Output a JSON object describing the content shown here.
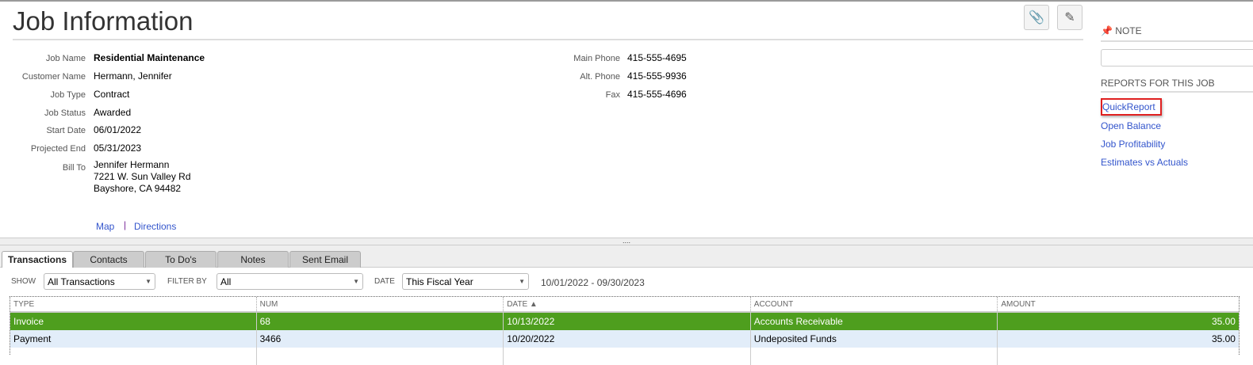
{
  "header": {
    "title": "Job Information"
  },
  "fields": {
    "job_name": {
      "label": "Job Name",
      "value": "Residential Maintenance"
    },
    "customer_name": {
      "label": "Customer Name",
      "value": "Hermann, Jennifer"
    },
    "job_type": {
      "label": "Job Type",
      "value": "Contract"
    },
    "job_status": {
      "label": "Job Status",
      "value": "Awarded"
    },
    "start_date": {
      "label": "Start Date",
      "value": "06/01/2022"
    },
    "projected_end": {
      "label": "Projected End",
      "value": "05/31/2023"
    },
    "bill_to": {
      "label": "Bill To",
      "line1": "Jennifer Hermann",
      "line2": "7221 W. Sun Valley Rd",
      "line3": "Bayshore, CA 94482"
    },
    "main_phone": {
      "label": "Main Phone",
      "value": "415-555-4695"
    },
    "alt_phone": {
      "label": "Alt. Phone",
      "value": "415-555-9936"
    },
    "fax": {
      "label": "Fax",
      "value": "415-555-4696"
    }
  },
  "links": {
    "map": "Map",
    "sep": "|",
    "directions": "Directions"
  },
  "sidebar": {
    "note_title": "NOTE",
    "reports_title": "REPORTS FOR THIS JOB",
    "reports": [
      "QuickReport",
      "Open Balance",
      "Job Profitability",
      "Estimates vs Actuals"
    ]
  },
  "divider": "....",
  "tabs": [
    "Transactions",
    "Contacts",
    "To Do's",
    "Notes",
    "Sent Email"
  ],
  "filters": {
    "show_label": "SHOW",
    "show_value": "All Transactions",
    "filter_label": "FILTER BY",
    "filter_value": "All",
    "date_label": "DATE",
    "date_value": "This Fiscal Year",
    "date_range": "10/01/2022 - 09/30/2023"
  },
  "table": {
    "headers": [
      "TYPE",
      "NUM",
      "DATE ▲",
      "ACCOUNT",
      "AMOUNT"
    ],
    "rows": [
      [
        "Invoice",
        "68",
        "10/13/2022",
        "Accounts Receivable",
        "35.00"
      ],
      [
        "Payment",
        "3466",
        "10/20/2022",
        "Undeposited Funds",
        "35.00"
      ]
    ]
  },
  "colors": {
    "selected_row": "#4e9e1e",
    "alt_row": "#e2edf9",
    "link": "#3355cc",
    "highlight": "#e02020"
  }
}
